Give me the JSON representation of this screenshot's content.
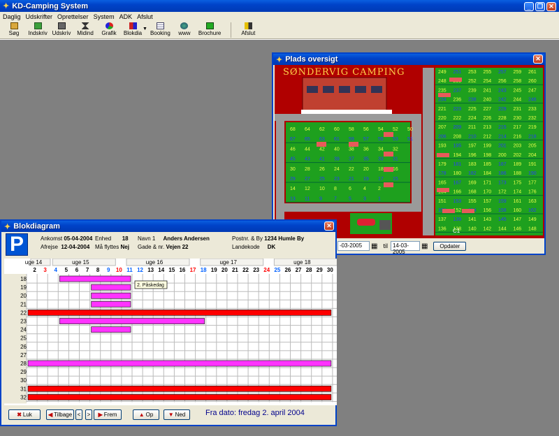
{
  "app": {
    "title": "KD-Camping System",
    "menu": [
      "Daglig",
      "Udskrifter",
      "Oprettelser",
      "System",
      "ADK",
      "Afslut"
    ],
    "toolbar": [
      {
        "label": "Søg",
        "icon": "search-icon"
      },
      {
        "label": "Indskriv",
        "icon": "checkin-icon"
      },
      {
        "label": "Udskriv",
        "icon": "checkout-icon"
      },
      {
        "label": "Midind",
        "icon": "hourglass-icon"
      },
      {
        "label": "Grafik",
        "icon": "chart-icon"
      },
      {
        "label": "Blokdia",
        "icon": "blockdiagram-icon"
      },
      {
        "label": "Booking",
        "icon": "calendar-icon"
      },
      {
        "label": "www",
        "icon": "globe-icon"
      },
      {
        "label": "Brochure",
        "icon": "brochure-icon"
      },
      {
        "label": "Afslut",
        "icon": "exit-icon"
      }
    ]
  },
  "plads": {
    "title": "Plads oversigt",
    "map_title": "SØNDERVIG CAMPING",
    "date_from": "-03-2005",
    "til_label": "til",
    "date_to": "14-03-2005",
    "update_label": "Opdater",
    "left_grid": [
      [
        "68",
        "64",
        "62",
        "60",
        "58",
        "56",
        "54",
        "52",
        "50"
      ],
      [
        "67",
        "65",
        "63",
        "61",
        "59",
        "57",
        "55",
        "53",
        "51"
      ],
      [
        "46",
        "44",
        "42",
        "40",
        "38",
        "36",
        "34",
        "32"
      ],
      [
        "45",
        "43",
        "41",
        "39",
        "37",
        "35",
        "33",
        "31"
      ],
      [
        "30",
        "28",
        "26",
        "24",
        "22",
        "20",
        "18",
        "16"
      ],
      [
        "29",
        "27",
        "25",
        "23",
        "21",
        "19",
        "17",
        "15"
      ],
      [
        "14",
        "12",
        "10",
        "8",
        "6",
        "4",
        "2"
      ],
      [
        "13",
        "11",
        "9",
        "7",
        "5",
        "3",
        "1"
      ]
    ],
    "right_grid": [
      [
        "249",
        "251",
        "253",
        "255",
        "257",
        "259",
        "261"
      ],
      [
        "248",
        "250",
        "252",
        "254",
        "256",
        "258",
        "260"
      ],
      [
        "235",
        "237",
        "239",
        "241",
        "243",
        "245",
        "247"
      ],
      [
        "234",
        "236",
        "238",
        "240",
        "242",
        "244",
        "246"
      ],
      [
        "221",
        "223",
        "225",
        "227",
        "229",
        "231",
        "233"
      ],
      [
        "220",
        "222",
        "224",
        "226",
        "228",
        "230",
        "232"
      ],
      [
        "207",
        "209",
        "211",
        "213",
        "215",
        "217",
        "219"
      ],
      [
        "206",
        "208",
        "210",
        "212",
        "214",
        "216",
        "218"
      ],
      [
        "193",
        "195",
        "197",
        "199",
        "201",
        "203",
        "205"
      ],
      [
        "192",
        "194",
        "196",
        "198",
        "200",
        "202",
        "204"
      ],
      [
        "179",
        "181",
        "183",
        "185",
        "187",
        "189",
        "191"
      ],
      [
        "178",
        "180",
        "182",
        "184",
        "186",
        "188",
        "190"
      ],
      [
        "165",
        "167",
        "169",
        "171",
        "173",
        "175",
        "177"
      ],
      [
        "164",
        "166",
        "168",
        "170",
        "172",
        "174",
        "176"
      ],
      [
        "151",
        "153",
        "155",
        "157",
        "159",
        "161",
        "163"
      ],
      [
        "150",
        "152",
        "154",
        "156",
        "158",
        "160",
        "162"
      ],
      [
        "137",
        "139",
        "141",
        "143",
        "145",
        "147",
        "149"
      ],
      [
        "136",
        "138",
        "140",
        "142",
        "144",
        "146",
        "148"
      ]
    ],
    "extra_labels": [
      "C1"
    ]
  },
  "blok": {
    "title": "Blokdiagram",
    "parking_letter": "P",
    "fields": {
      "ankomst_label": "Ankomst",
      "ankomst": "05-04-2004",
      "afrejse_label": "Afrejse",
      "afrejse": "12-04-2004",
      "enhed_label": "Enhed",
      "enhed": "18",
      "flyttes_label": "Må flyttes",
      "flyttes": "Nej",
      "navn_label": "Navn 1",
      "navn": "Anders Andersen",
      "gade_label": "Gade & nr.",
      "gade": "Vejen 22",
      "postnr_label": "Postnr. & By",
      "postnr": "1234 Humle By",
      "land_label": "Landekode",
      "land": "DK"
    },
    "weeks": [
      "uge 14",
      "uge 15",
      "uge 16",
      "uge 17",
      "uge 18"
    ],
    "days": [
      "2",
      "3",
      "4",
      "5",
      "6",
      "7",
      "8",
      "9",
      "10",
      "11",
      "12",
      "13",
      "14",
      "15",
      "16",
      "17",
      "18",
      "19",
      "20",
      "21",
      "22",
      "23",
      "24",
      "25",
      "26",
      "27",
      "28",
      "29",
      "30"
    ],
    "day_colors": {
      "red": [
        "3",
        "10",
        "17",
        "24"
      ],
      "blue": [
        "4",
        "9",
        "11",
        "12",
        "18",
        "25"
      ]
    },
    "rows": [
      "18",
      "19",
      "20",
      "21",
      "22",
      "23",
      "24",
      "25",
      "26",
      "27",
      "28",
      "29",
      "30",
      "31",
      "32"
    ],
    "bars": [
      {
        "row": "18",
        "start": "5",
        "end": "11",
        "color": "#ff33ff"
      },
      {
        "row": "19",
        "start": "8",
        "end": "11",
        "color": "#ff33ff"
      },
      {
        "row": "20",
        "start": "8",
        "end": "11",
        "color": "#ff33ff"
      },
      {
        "row": "21",
        "start": "8",
        "end": "11",
        "color": "#ff33ff"
      },
      {
        "row": "22",
        "start": "2",
        "end": "30",
        "color": "#ff0000"
      },
      {
        "row": "23",
        "start": "5",
        "end": "18",
        "color": "#ff33ff"
      },
      {
        "row": "24",
        "start": "8",
        "end": "11",
        "color": "#ff33ff"
      },
      {
        "row": "28",
        "start": "2",
        "end": "30",
        "color": "#ff33ff"
      },
      {
        "row": "31",
        "start": "2",
        "end": "30",
        "color": "#ff0000"
      },
      {
        "row": "32",
        "start": "2",
        "end": "30",
        "color": "#ff0000"
      }
    ],
    "tooltip": "2. Påskedag",
    "buttons": {
      "luk": "Luk",
      "tilbage": "Tilbage",
      "prev": "<",
      "next": ">",
      "frem": "Frem",
      "op": "Op",
      "ned": "Ned"
    },
    "fra_dato": "Fra dato: fredag 2. april 2004"
  },
  "colors": {
    "title_blue": "#0043c8",
    "close_red": "#d0402c",
    "bar_pink": "#ff33ff",
    "bar_red": "#ff0000"
  }
}
